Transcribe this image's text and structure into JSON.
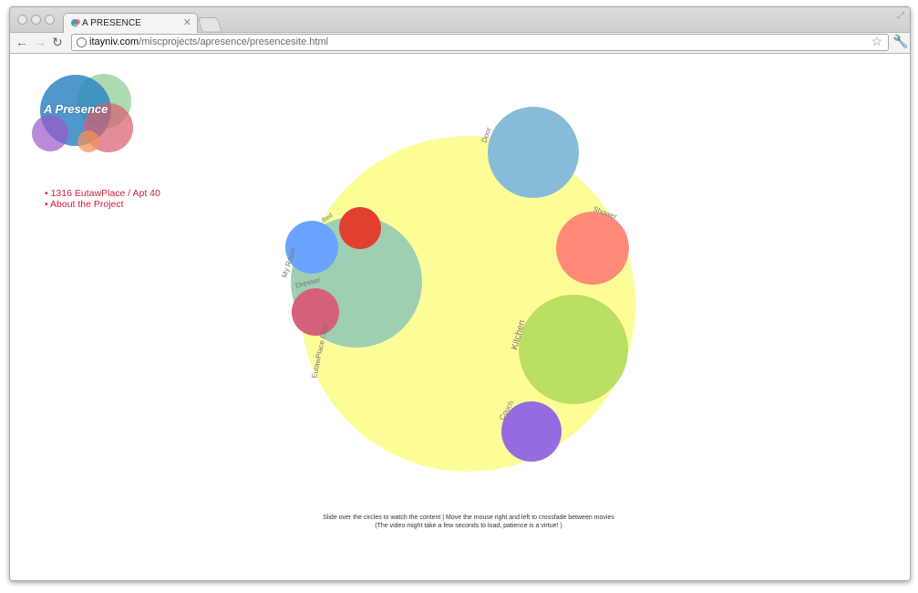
{
  "browser": {
    "tab_title": "A PRESENCE",
    "url_domain": "itayniv.com",
    "url_path": "/miscprojects/apresence/presencesite.html",
    "icons": {
      "back": "back-arrow-icon",
      "forward": "forward-arrow-icon",
      "reload": "reload-icon",
      "star": "star-icon",
      "wrench": "wrench-icon",
      "close": "close-icon"
    }
  },
  "logo": {
    "text": "A Presence",
    "colors": [
      "#2f86c4",
      "#8fcf93",
      "#d95c6c",
      "#9b59c9",
      "#f2935b"
    ]
  },
  "nav_links": [
    "• 1316 EutawPlace / Apt 40",
    "• About the Project"
  ],
  "circles": [
    {
      "label": "Door",
      "color": "#87bcd9"
    },
    {
      "label": "Shower",
      "color": "#ff8a78"
    },
    {
      "label": "Kitchen",
      "color": "#badf62"
    },
    {
      "label": "Couch",
      "color": "#966be0"
    },
    {
      "label": "Bed",
      "color": "#e14030"
    },
    {
      "label": "Dresser",
      "color": "#d6607a"
    },
    {
      "label": "My Room",
      "color": "#9ecfb2"
    },
    {
      "label": "EutawPlace / Apt",
      "color": "#fdfd98"
    }
  ],
  "footer": {
    "line1": "Slide over the circles to watch the content | Move the mouse right and left to crossfade between movies",
    "line2": "(The video might take a few seconds to load, patience is a virtue! )"
  }
}
